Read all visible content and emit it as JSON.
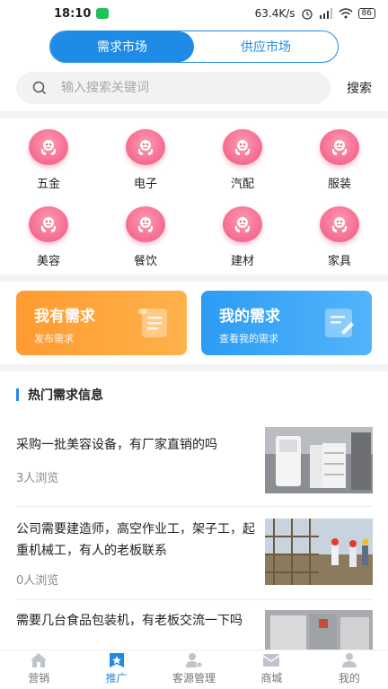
{
  "status_bar": {
    "time": "18:10",
    "speed": "63.4K/s",
    "battery": "86"
  },
  "market_tabs": [
    {
      "label": "需求市场",
      "active": true
    },
    {
      "label": "供应市场",
      "active": false
    }
  ],
  "search": {
    "placeholder": "输入搜索关键词",
    "value": "",
    "button_label": "搜索"
  },
  "categories": [
    {
      "label": "五金"
    },
    {
      "label": "电子"
    },
    {
      "label": "汽配"
    },
    {
      "label": "服装"
    },
    {
      "label": "美容"
    },
    {
      "label": "餐饮"
    },
    {
      "label": "建材"
    },
    {
      "label": "家具"
    }
  ],
  "action_cards": {
    "publish": {
      "title": "我有需求",
      "subtitle": "发布需求",
      "color": "#ff9f35"
    },
    "mine": {
      "title": "我的需求",
      "subtitle": "查看我的需求",
      "color": "#3aa6f7"
    }
  },
  "hot": {
    "title": "热门需求信息",
    "items": [
      {
        "text": "采购一批美容设备，有厂家直销的吗",
        "views": "3人浏览"
      },
      {
        "text": "公司需要建造师，高空作业工，架子工，起重机械工，有人的老板联系",
        "views": "0人浏览"
      },
      {
        "text": "需要几台食品包装机，有老板交流一下吗",
        "views": ""
      }
    ]
  },
  "tab_bar": [
    {
      "label": "营销",
      "icon": "home-icon",
      "active": false
    },
    {
      "label": "推广",
      "icon": "star-tag-icon",
      "active": true
    },
    {
      "label": "客源管理",
      "icon": "user-gear-icon",
      "active": false
    },
    {
      "label": "商城",
      "icon": "mail-icon",
      "active": false
    },
    {
      "label": "我的",
      "icon": "person-icon",
      "active": false
    }
  ],
  "colors": {
    "accent": "#1e8be6",
    "category_pink": "#f0557d",
    "orange": "#ff9f35",
    "blue": "#3aa6f7"
  }
}
